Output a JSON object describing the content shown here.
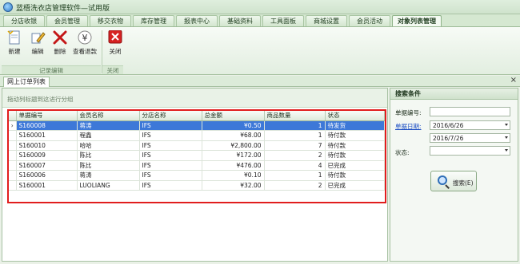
{
  "window": {
    "title": "蓝梧洗衣店管理软件—试用版"
  },
  "menu_tabs": [
    "分店收银",
    "会员管理",
    "移交衣物",
    "库存管理",
    "报表中心",
    "基础资料",
    "工具面板",
    "商城设置",
    "会员活动",
    "对象列表管理"
  ],
  "active_menu_tab": "对象列表管理",
  "ribbon": {
    "buttons": {
      "new": "新建",
      "edit": "编辑",
      "delete": "删除",
      "view_refund": "查看退款",
      "close": "关闭"
    },
    "groups": {
      "record_edit": "记录编辑",
      "close": "关闭"
    }
  },
  "doc_tab": {
    "label": "网上订单列表"
  },
  "grid": {
    "group_hint": "拖动列标题到这进行分组",
    "columns": [
      "单据编号",
      "会员名称",
      "分店名称",
      "总金额",
      "商品数量",
      "状态"
    ],
    "rows": [
      {
        "id": "S160008",
        "member": "蒋涛",
        "store": "IFS",
        "amount": "¥0.50",
        "qty": "1",
        "status": "待发货"
      },
      {
        "id": "S160001",
        "member": "程鑫",
        "store": "IFS",
        "amount": "¥68.00",
        "qty": "1",
        "status": "待付款"
      },
      {
        "id": "S160010",
        "member": "哈哈",
        "store": "IFS",
        "amount": "¥2,800.00",
        "qty": "7",
        "status": "待付款"
      },
      {
        "id": "S160009",
        "member": "陈比",
        "store": "IFS",
        "amount": "¥172.00",
        "qty": "2",
        "status": "待付款"
      },
      {
        "id": "S160007",
        "member": "陈比",
        "store": "IFS",
        "amount": "¥476.00",
        "qty": "4",
        "status": "已完成"
      },
      {
        "id": "S160006",
        "member": "蒋涛",
        "store": "IFS",
        "amount": "¥0.10",
        "qty": "1",
        "status": "待付款"
      },
      {
        "id": "S160001",
        "member": "LUOLIANG",
        "store": "IFS",
        "amount": "¥32.00",
        "qty": "2",
        "status": "已完成"
      }
    ],
    "selected_row_indicator": "›"
  },
  "search_panel": {
    "title": "搜索条件",
    "doc_no_label": "单据编号:",
    "doc_no_value": "",
    "date_label": "单据日期:",
    "date_from": "2016/6/26",
    "date_to": "2016/7/26",
    "status_label": "状态:",
    "status_value": "",
    "search_button": "搜索(E)"
  },
  "colors": {
    "selected_row": "#3d78d8",
    "highlight_border": "#e11d1d",
    "ribbon_bg": "#e2eee0"
  }
}
